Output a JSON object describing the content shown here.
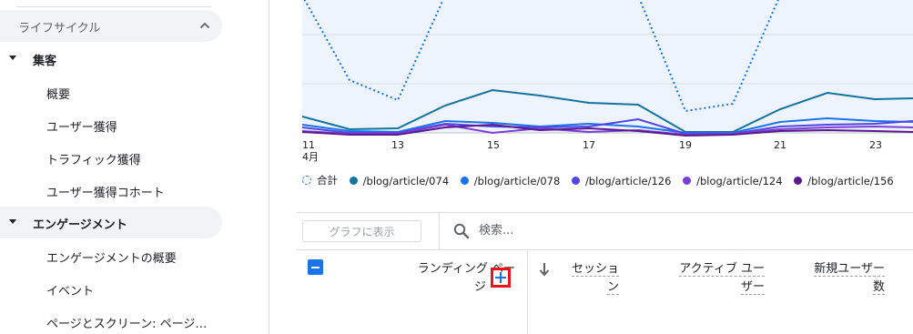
{
  "sidebar": {
    "section_label": "ライフサイクル",
    "groups": [
      {
        "label": "集客",
        "items": [
          "概要",
          "ユーザー獲得",
          "トラフィック獲得",
          "ユーザー獲得コホート"
        ]
      },
      {
        "label": "エンゲージメント",
        "items": [
          "エンゲージメントの概要",
          "イベント",
          "ページとスクリーン: ページ…"
        ]
      }
    ]
  },
  "chart": {
    "x_ticks": [
      "11",
      "13",
      "15",
      "17",
      "19",
      "21",
      "23"
    ],
    "x_month": "4月",
    "legend": [
      {
        "label": "合計",
        "color": "#1a73e8",
        "dashed": true
      },
      {
        "label": "/blog/article/074",
        "color": "#12739e"
      },
      {
        "label": "/blog/article/078",
        "color": "#1a73e8"
      },
      {
        "label": "/blog/article/126",
        "color": "#4f46e5"
      },
      {
        "label": "/blog/article/124",
        "color": "#7b3fd4"
      },
      {
        "label": "/blog/article/156",
        "color": "#5b1a8c"
      }
    ]
  },
  "toolbar": {
    "graph_button": "グラフに表示",
    "search_placeholder": "検索..."
  },
  "table": {
    "dimension_header": [
      "ランディング ペー",
      "ジ"
    ],
    "metrics": [
      {
        "lines": [
          "セッショ",
          "ン"
        ]
      },
      {
        "lines": [
          "アクティブ ユー",
          "ザー"
        ]
      },
      {
        "lines": [
          "新規ユーザー",
          "数"
        ]
      }
    ]
  }
}
